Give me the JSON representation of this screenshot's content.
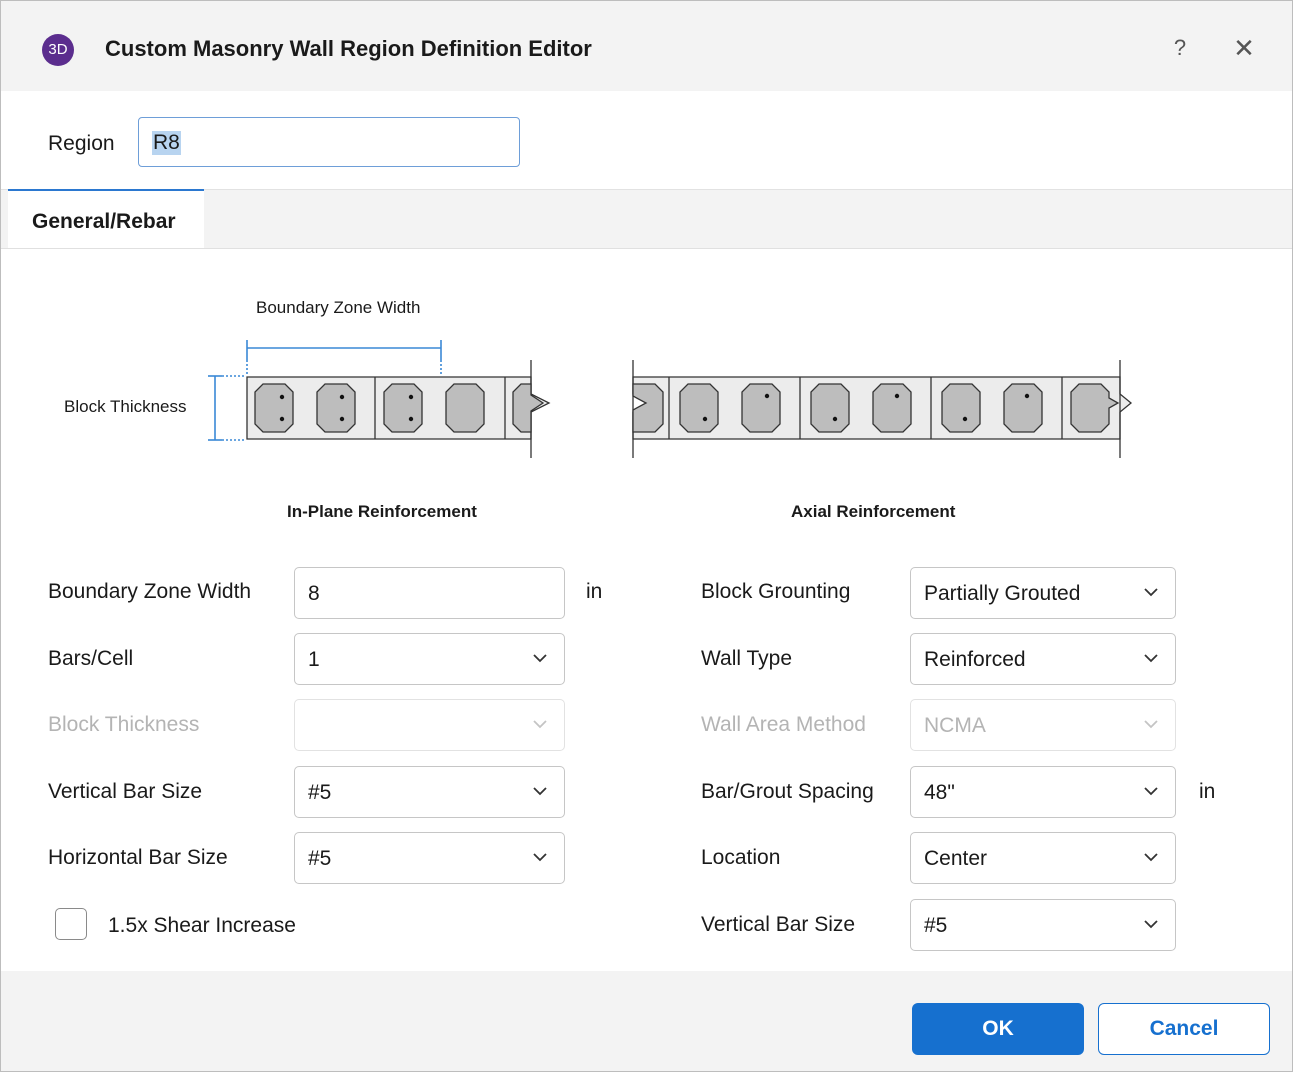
{
  "window": {
    "title": "Custom Masonry Wall Region Definition Editor",
    "app_icon_text": "3D",
    "help_glyph": "?",
    "close_glyph": "✕",
    "accent_color": "#1670cf"
  },
  "region": {
    "label": "Region",
    "value": "R8"
  },
  "tabs": [
    {
      "label": "General/Rebar",
      "active": true
    }
  ],
  "diagram": {
    "boundary_zone_width_label": "Boundary Zone Width",
    "block_thickness_label": "Block Thickness",
    "in_plane_caption": "In-Plane Reinforcement",
    "axial_caption": "Axial Reinforcement"
  },
  "left_fields": {
    "boundary_zone_width": {
      "label": "Boundary Zone Width",
      "value": "8",
      "unit": "in"
    },
    "bars_per_cell": {
      "label": "Bars/Cell",
      "value": "1"
    },
    "block_thickness": {
      "label": "Block Thickness",
      "value": "",
      "disabled": true
    },
    "vertical_bar_size": {
      "label": "Vertical Bar Size",
      "value": "#5"
    },
    "horizontal_bar_size": {
      "label": "Horizontal Bar Size",
      "value": "#5"
    },
    "shear_increase": {
      "label": "1.5x Shear Increase",
      "checked": false
    }
  },
  "right_fields": {
    "block_grouting": {
      "label": "Block Grounting",
      "value": "Partially Grouted"
    },
    "wall_type": {
      "label": "Wall Type",
      "value": "Reinforced"
    },
    "wall_area_method": {
      "label": "Wall Area Method",
      "value": "NCMA",
      "disabled": true
    },
    "bar_grout_spacing": {
      "label": "Bar/Grout Spacing",
      "value": "48\"",
      "unit": "in"
    },
    "location": {
      "label": "Location",
      "value": "Center"
    },
    "vertical_bar_size": {
      "label": "Vertical Bar Size",
      "value": "#5"
    }
  },
  "buttons": {
    "ok": "OK",
    "cancel": "Cancel"
  }
}
